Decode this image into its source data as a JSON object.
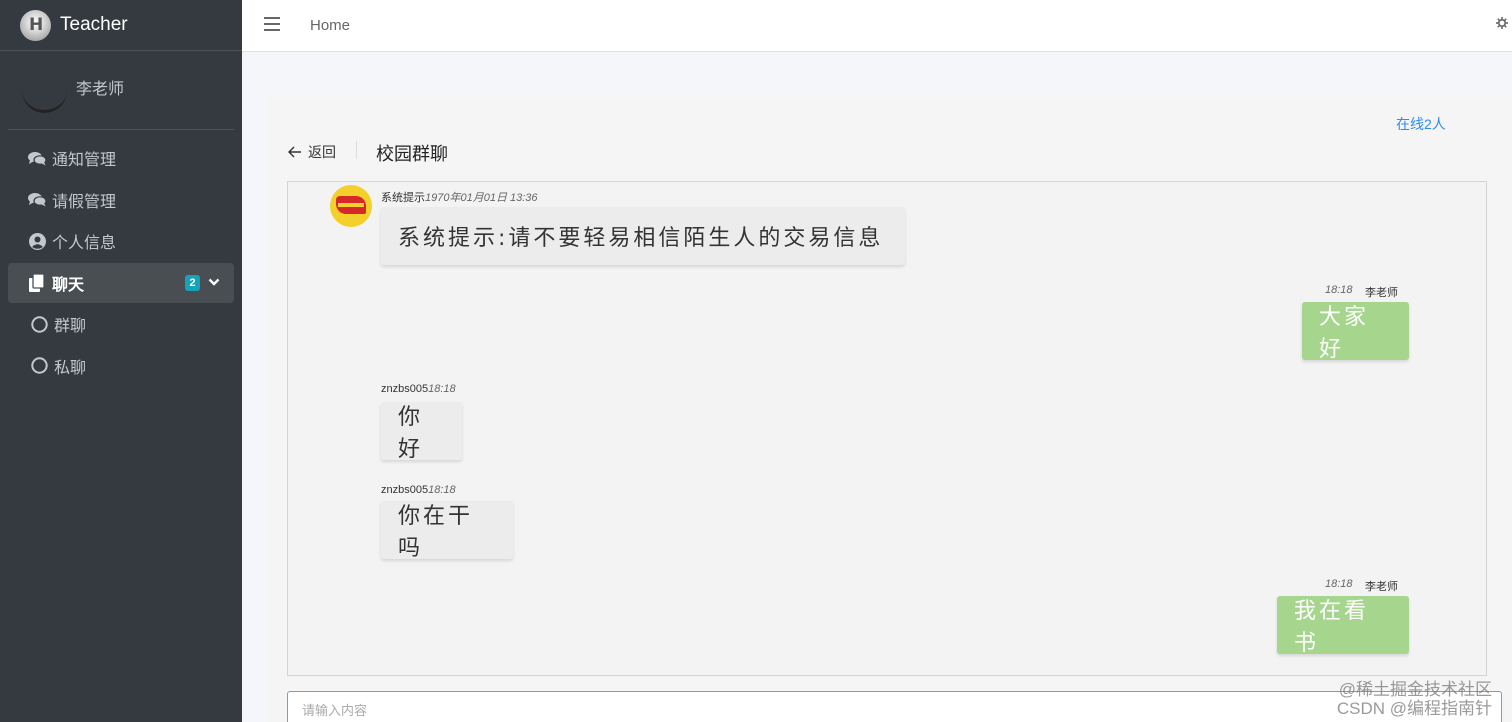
{
  "brand": {
    "title": "Teacher"
  },
  "user": {
    "name": "李老师"
  },
  "sidebar": {
    "items": [
      {
        "label": "通知管理",
        "icon": "comments-icon"
      },
      {
        "label": "请假管理",
        "icon": "comments-icon"
      },
      {
        "label": "个人信息",
        "icon": "user-circle-icon"
      },
      {
        "label": "聊天",
        "icon": "copy-icon",
        "badge": "2",
        "active": true
      },
      {
        "label": "群聊",
        "icon": "circle-icon"
      },
      {
        "label": "私聊",
        "icon": "circle-icon"
      }
    ]
  },
  "topbar": {
    "home_label": "Home"
  },
  "chat": {
    "online": "在线2人",
    "back_label": "返回",
    "title": "校园群聊",
    "input_placeholder": "请输入内容",
    "messages": [
      {
        "sender": "系统提示",
        "time": "1970年01月01日 13:36",
        "text": "系统提示:请不要轻易相信陌生人的交易信息",
        "mine": false,
        "system": true
      },
      {
        "sender": "李老师",
        "time": "18:18",
        "text": "大家好",
        "mine": true
      },
      {
        "sender": "znzbs005",
        "time": "18:18",
        "text": "你好",
        "mine": false
      },
      {
        "sender": "znzbs005",
        "time": "18:18",
        "text": "你在干吗",
        "mine": false
      },
      {
        "sender": "李老师",
        "time": "18:18",
        "text": "我在看书",
        "mine": true
      }
    ]
  },
  "watermark": {
    "line1": "@稀土掘金技术社区",
    "line2": "CSDN @编程指南针"
  },
  "colors": {
    "sidebar_bg": "#343a40",
    "mine_bubble": "#a6d68e",
    "link_blue": "#2d8cf0",
    "badge": "#17a2b8"
  }
}
